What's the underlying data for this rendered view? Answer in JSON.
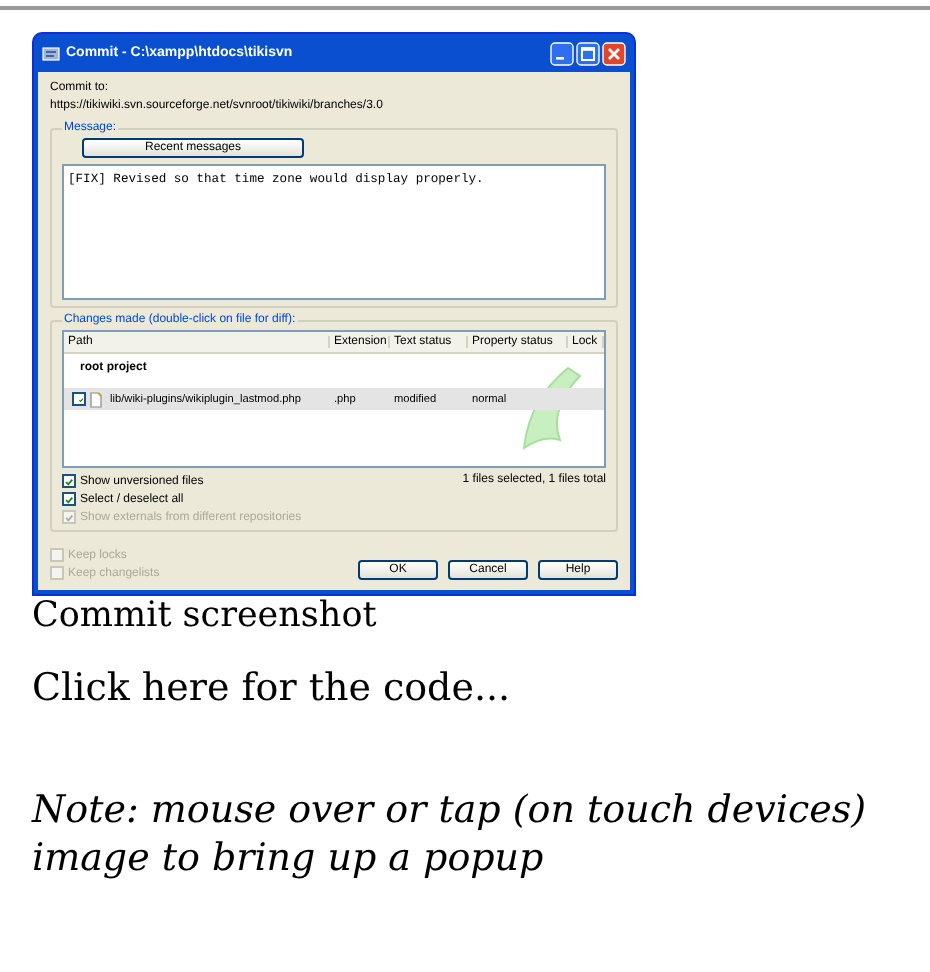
{
  "dialog": {
    "title": "Commit - C:\\xampp\\htdocs\\tikisvn",
    "commit_to_label": "Commit to:",
    "url": "https://tikiwiki.svn.sourceforge.net/svnroot/tikiwiki/branches/3.0",
    "message": {
      "label": "Message:",
      "recent_button": "Recent messages",
      "text": "[FIX] Revised so that time zone would display properly."
    },
    "changes": {
      "label": "Changes made (double-click on file for diff):",
      "columns": [
        "Path",
        "Extension",
        "Text status",
        "Property status",
        "Lock"
      ],
      "group": "root project",
      "rows": [
        {
          "checked": true,
          "selected": true,
          "path": "lib/wiki-plugins/wikiplugin_lastmod.php",
          "extension": ".php",
          "text_status": "modified",
          "property_status": "normal"
        }
      ]
    },
    "options": [
      {
        "label": "Show unversioned files",
        "checked": true,
        "disabled": false
      },
      {
        "label": "Select / deselect all",
        "checked": true,
        "disabled": false
      },
      {
        "label": "Show externals from different repositories",
        "checked": true,
        "disabled": true
      }
    ],
    "summary": "1 files selected, 1 files total",
    "keep_options": [
      {
        "label": "Keep locks",
        "checked": false,
        "disabled": true
      },
      {
        "label": "Keep changelists",
        "checked": false,
        "disabled": true
      }
    ],
    "buttons": [
      "OK",
      "Cancel",
      "Help"
    ]
  },
  "caption": "Commit screenshot",
  "link": "Click here for the code...",
  "note": "Note: mouse over or tap (on touch devices) image to bring up a popup"
}
